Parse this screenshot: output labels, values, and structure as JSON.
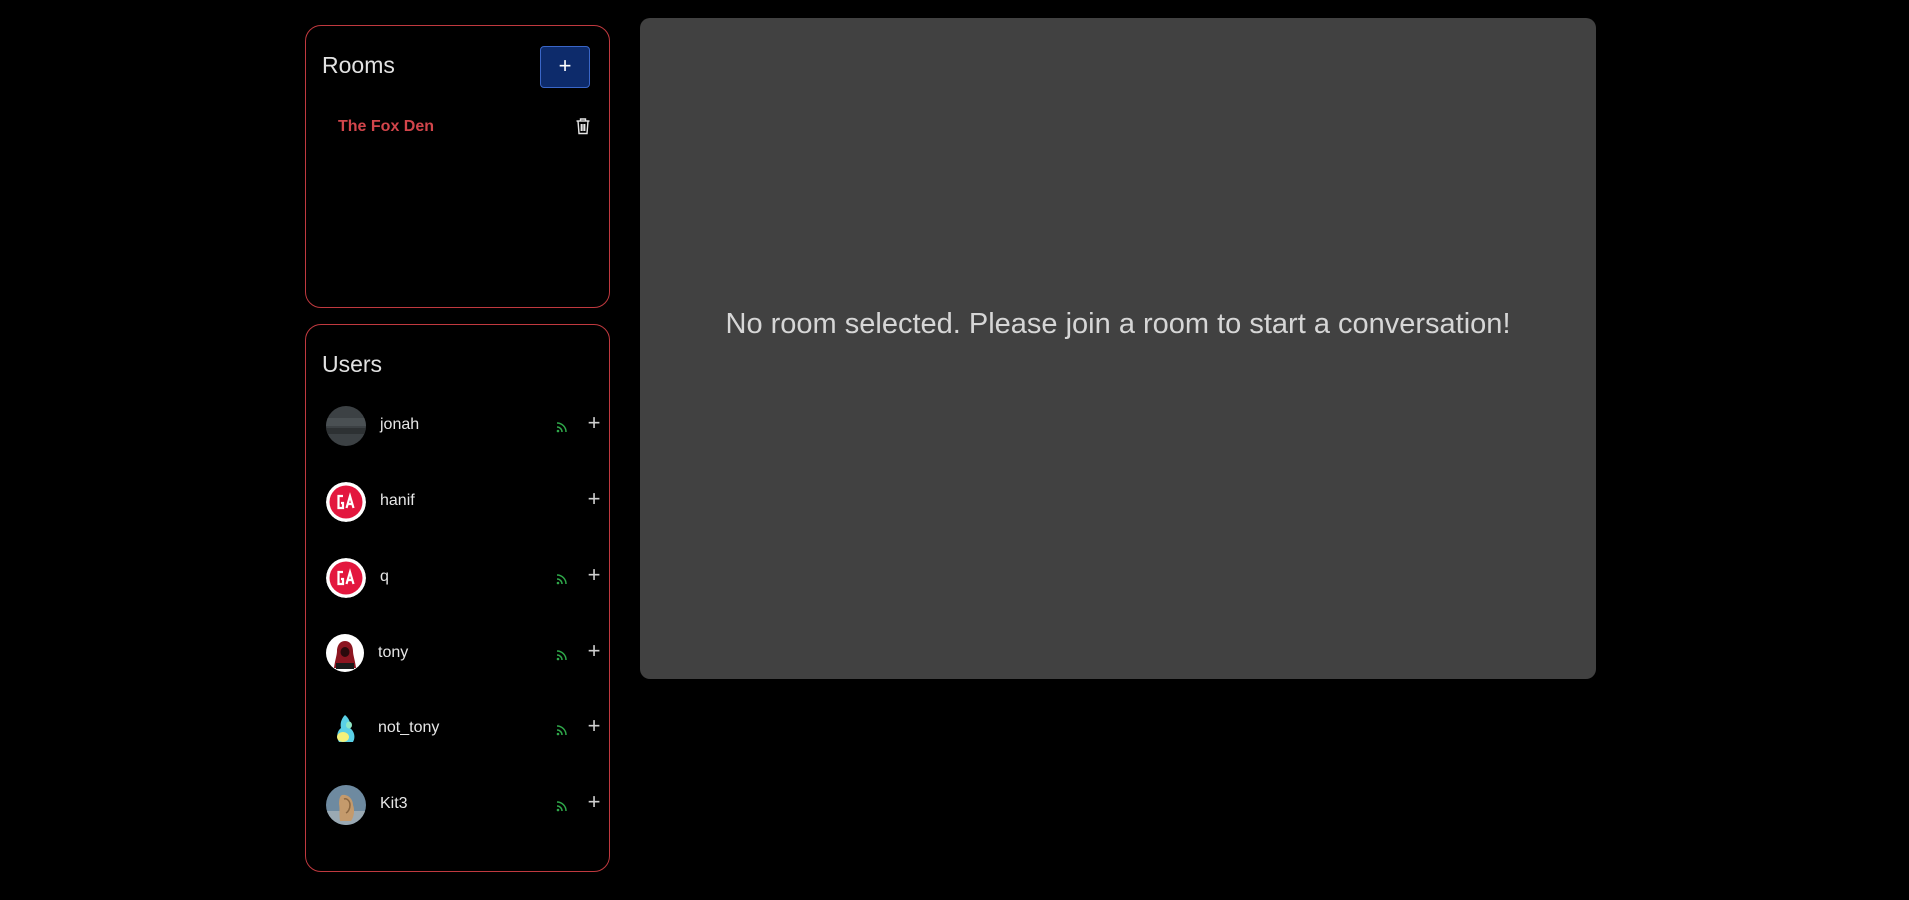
{
  "rooms": {
    "title": "Rooms",
    "add_button_label": "+",
    "items": [
      {
        "name": "The Fox Den"
      }
    ]
  },
  "users": {
    "title": "Users",
    "add_label": "+",
    "items": [
      {
        "name": "jonah",
        "online": true,
        "avatar": "dark-photo"
      },
      {
        "name": "hanif",
        "online": false,
        "avatar": "ga-logo"
      },
      {
        "name": "q",
        "online": true,
        "avatar": "ga-logo"
      },
      {
        "name": "tony",
        "online": true,
        "avatar": "hooded-figure"
      },
      {
        "name": "not_tony",
        "online": true,
        "avatar": "colorful-figure"
      },
      {
        "name": "Kit3",
        "online": true,
        "avatar": "animal-photo"
      }
    ]
  },
  "chat": {
    "empty_message": "No room selected. Please join a room to start a conversation!"
  },
  "colors": {
    "panel_border": "#c0393f",
    "room_name": "#d2454b",
    "online": "#2fa84a",
    "add_button_bg": "#0d2b6b",
    "chat_bg": "#414141"
  }
}
